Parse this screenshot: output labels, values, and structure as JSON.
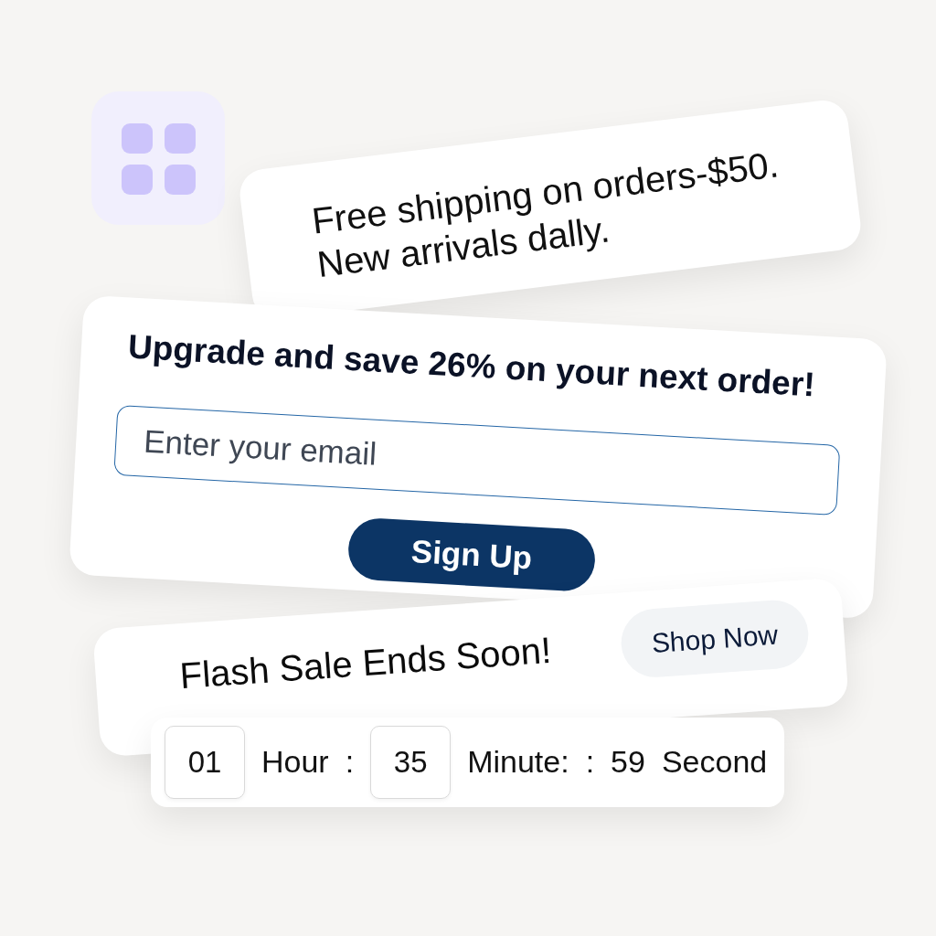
{
  "promo_banner": {
    "lines": [
      "Free shipping on orders-$50.",
      "New arrivals dally."
    ]
  },
  "signup_card": {
    "heading": "Upgrade and save 26% on your next order!",
    "email": {
      "placeholder": "Enter your email"
    },
    "button": "Sign Up"
  },
  "flash_sale_card": {
    "title": "Flash Sale Ends Soon!",
    "button": "Shop Now"
  },
  "countdown": {
    "items": [
      {
        "kind": "box",
        "text": "01"
      },
      {
        "kind": "label",
        "text": "Hour"
      },
      {
        "kind": "separator",
        "text": ":"
      },
      {
        "kind": "box",
        "text": "35"
      },
      {
        "kind": "label",
        "text": "Minute:"
      },
      {
        "kind": "separator",
        "text": ":"
      },
      {
        "kind": "value",
        "text": "59"
      },
      {
        "kind": "label",
        "text": "Second"
      }
    ]
  }
}
